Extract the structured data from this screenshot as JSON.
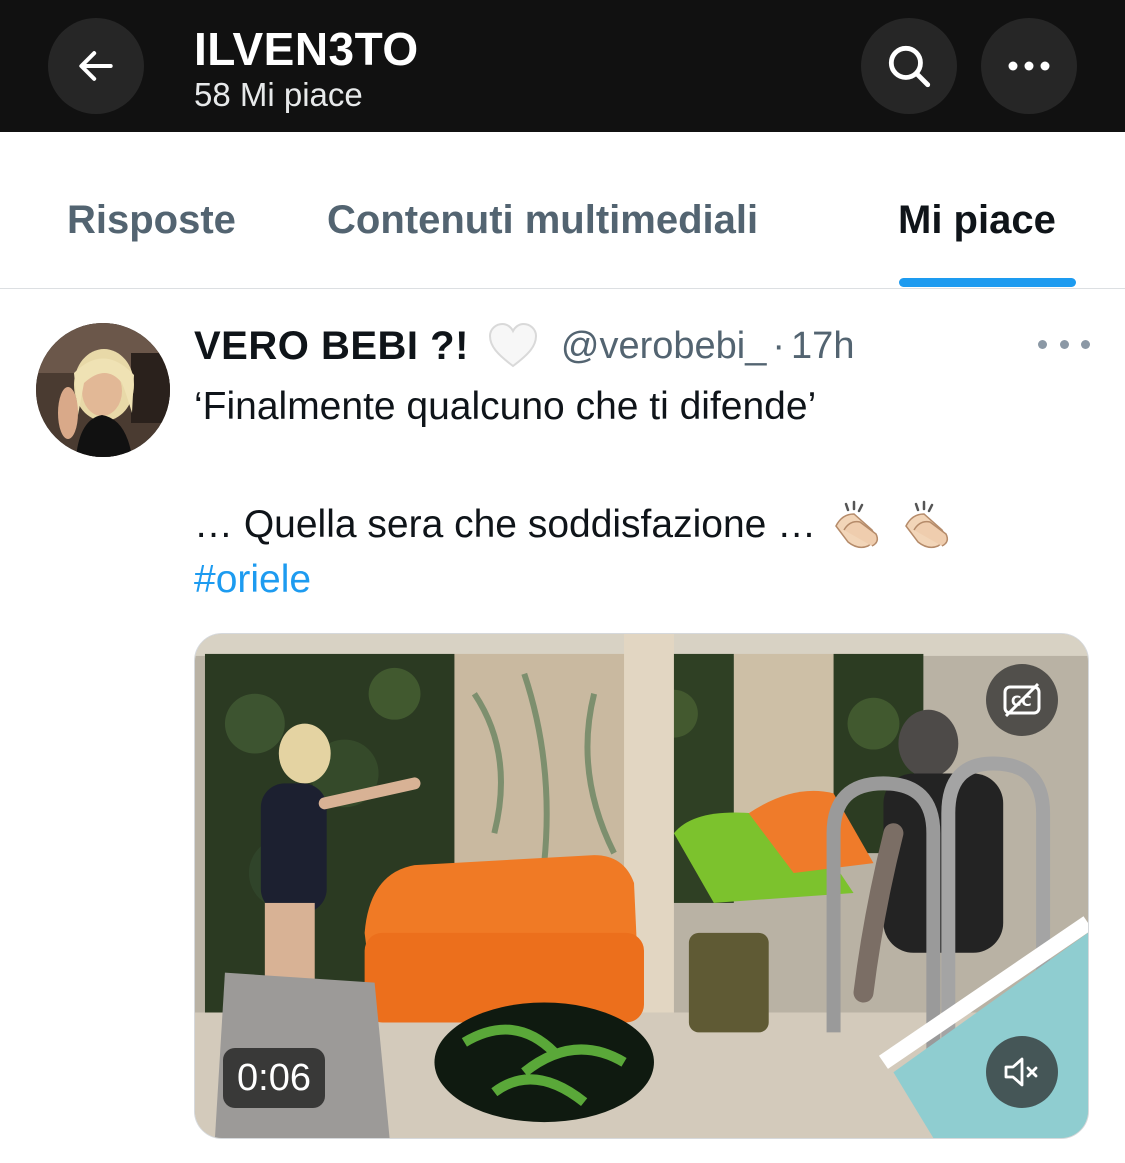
{
  "header": {
    "title": "ILVEN3TO",
    "subtitle": "58 Mi piace",
    "back_icon": "arrow-left-icon",
    "search_icon": "search-icon",
    "more_icon": "more-horizontal-icon"
  },
  "tabs": [
    {
      "label": "Risposte",
      "selected": false
    },
    {
      "label": "Contenuti multimediali",
      "selected": false
    },
    {
      "label": "Mi piace",
      "selected": true
    }
  ],
  "tweet": {
    "author_name": "VERO BEBI ?!",
    "author_emoji": "white-heart",
    "handle": "@verobebi_",
    "separator": "·",
    "time": "17h",
    "text_line_1": "‘Finalmente qualcuno che ti difende’",
    "text_line_2": "…  Quella sera che soddisfazione  …",
    "emojis": [
      "clapping-hands",
      "clapping-hands"
    ],
    "hashtag": "#oriele",
    "media": {
      "type": "video",
      "duration": "0:06",
      "cc_icon": "captions-off-icon",
      "mute_icon": "volume-muted-icon"
    }
  },
  "colors": {
    "header_bg": "#111111",
    "accent": "#1d9bf0",
    "muted_text": "#536471"
  }
}
